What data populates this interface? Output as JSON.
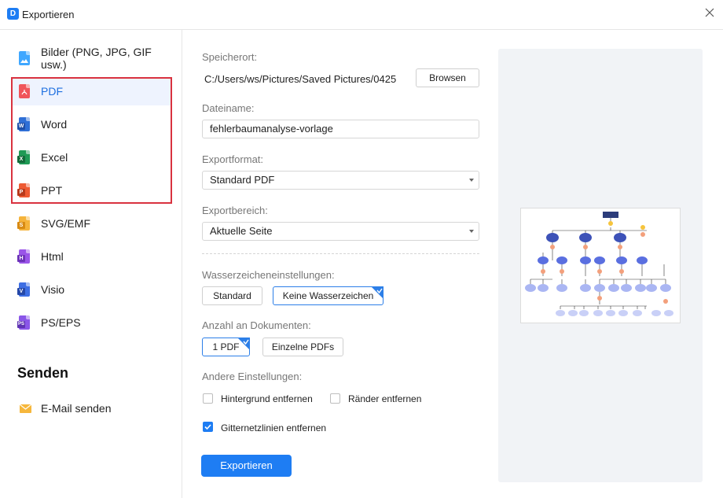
{
  "window": {
    "title": "Exportieren"
  },
  "sidebar": {
    "items": [
      {
        "label": "Bilder (PNG, JPG, GIF usw.)",
        "icon": "image-file-icon",
        "color": "#3fa7ff",
        "badge": ""
      },
      {
        "label": "PDF",
        "icon": "pdf-file-icon",
        "color": "#f0555a",
        "badge": ""
      },
      {
        "label": "Word",
        "icon": "word-file-icon",
        "color": "#2f6fd6",
        "badge": "W"
      },
      {
        "label": "Excel",
        "icon": "excel-file-icon",
        "color": "#1f9a55",
        "badge": "X"
      },
      {
        "label": "PPT",
        "icon": "ppt-file-icon",
        "color": "#ee5a32",
        "badge": "P"
      },
      {
        "label": "SVG/EMF",
        "icon": "svg-file-icon",
        "color": "#f5b33a",
        "badge": "S"
      },
      {
        "label": "Html",
        "icon": "html-file-icon",
        "color": "#9a55e8",
        "badge": "H"
      },
      {
        "label": "Visio",
        "icon": "visio-file-icon",
        "color": "#3d6ee3",
        "badge": "V"
      },
      {
        "label": "PS/EPS",
        "icon": "ps-file-icon",
        "color": "#8a56e8",
        "badge": "PS"
      }
    ],
    "send_heading": "Senden",
    "email_label": "E-Mail senden"
  },
  "form": {
    "location_label": "Speicherort:",
    "location_value": "C:/Users/ws/Pictures/Saved Pictures/0425",
    "browse_label": "Browsen",
    "filename_label": "Dateiname:",
    "filename_value": "fehlerbaumanalyse-vorlage",
    "format_label": "Exportformat:",
    "format_value": "Standard PDF",
    "range_label": "Exportbereich:",
    "range_value": "Aktuelle Seite",
    "watermark_label": "Wasserzeicheneinstellungen:",
    "watermark_standard": "Standard",
    "watermark_none": "Keine Wasserzeichen",
    "docs_label": "Anzahl an Dokumenten:",
    "docs_one": "1 PDF",
    "docs_single": "Einzelne PDFs",
    "other_label": "Andere Einstellungen:",
    "remove_background": "Hintergrund entfernen",
    "remove_borders": "Ränder entfernen",
    "remove_grid": "Gitternetzlinien entfernen",
    "export_button": "Exportieren"
  },
  "colors": {
    "accent": "#1e7df3",
    "highlight_box": "#d9323f"
  }
}
